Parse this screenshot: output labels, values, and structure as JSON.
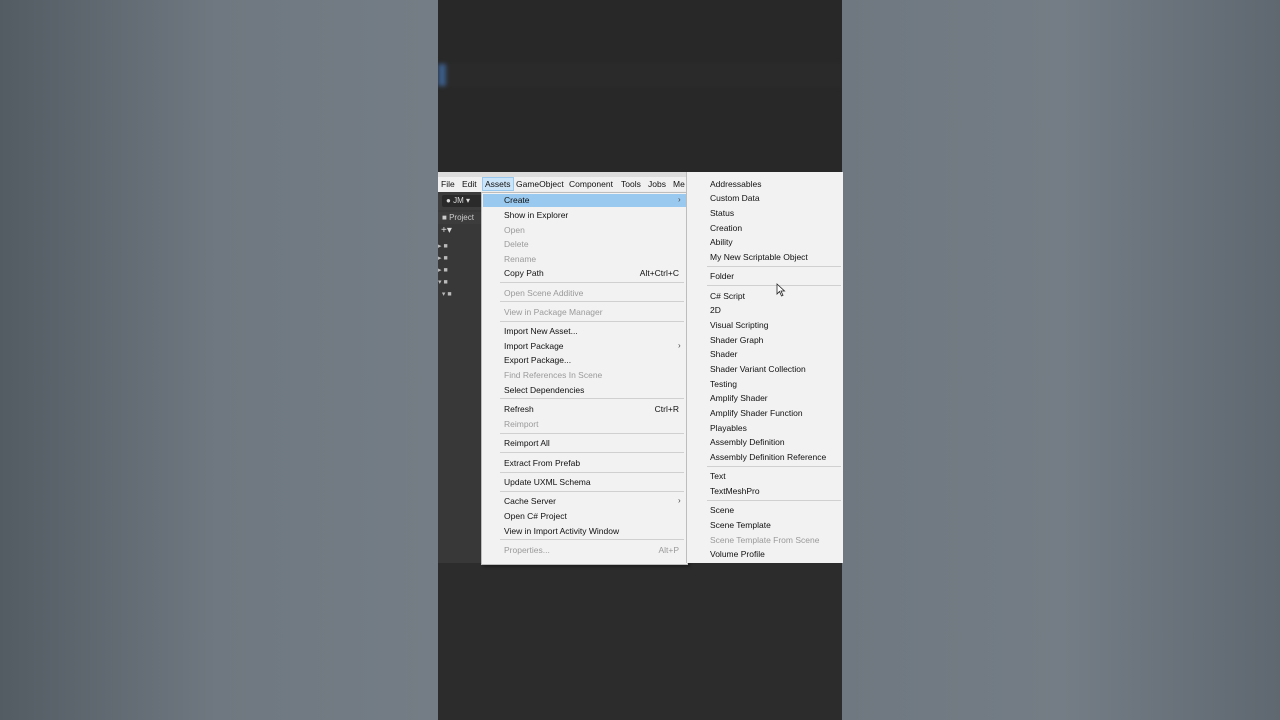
{
  "menubar": {
    "items": [
      "File",
      "Edit",
      "Assets",
      "GameObject",
      "Component",
      "Tools",
      "Jobs",
      "Me"
    ],
    "active": "Assets"
  },
  "toolbar": {
    "account_label": "JM"
  },
  "project_panel": {
    "tab_label": "Project"
  },
  "assets_menu": {
    "items": [
      {
        "label": "Create",
        "has_submenu": true,
        "highlighted": true
      },
      {
        "label": "Show in Explorer"
      },
      {
        "label": "Open",
        "disabled": true
      },
      {
        "label": "Delete",
        "disabled": true
      },
      {
        "label": "Rename",
        "disabled": true
      },
      {
        "label": "Copy Path",
        "shortcut": "Alt+Ctrl+C"
      },
      {
        "label": "Open Scene Additive",
        "disabled": true
      },
      {
        "label": "View in Package Manager",
        "disabled": true
      },
      {
        "label": "Import New Asset..."
      },
      {
        "label": "Import Package",
        "has_submenu": true
      },
      {
        "label": "Export Package..."
      },
      {
        "label": "Find References In Scene",
        "disabled": true
      },
      {
        "label": "Select Dependencies"
      },
      {
        "label": "Refresh",
        "shortcut": "Ctrl+R"
      },
      {
        "label": "Reimport",
        "disabled": true
      },
      {
        "label": "Reimport All"
      },
      {
        "label": "Extract From Prefab"
      },
      {
        "label": "Update UXML Schema"
      },
      {
        "label": "Cache Server",
        "has_submenu": true
      },
      {
        "label": "Open C# Project"
      },
      {
        "label": "View in Import Activity Window"
      },
      {
        "label": "Properties...",
        "shortcut": "Alt+P",
        "disabled": true
      }
    ]
  },
  "create_submenu": {
    "items": [
      {
        "label": "Addressables"
      },
      {
        "label": "Custom Data"
      },
      {
        "label": "Status"
      },
      {
        "label": "Creation"
      },
      {
        "label": "Ability"
      },
      {
        "label": "My New Scriptable Object"
      },
      {
        "label": "Folder"
      },
      {
        "label": "C# Script"
      },
      {
        "label": "2D"
      },
      {
        "label": "Visual Scripting"
      },
      {
        "label": "Shader Graph"
      },
      {
        "label": "Shader"
      },
      {
        "label": "Shader Variant Collection"
      },
      {
        "label": "Testing"
      },
      {
        "label": "Amplify Shader"
      },
      {
        "label": "Amplify Shader Function"
      },
      {
        "label": "Playables"
      },
      {
        "label": "Assembly Definition"
      },
      {
        "label": "Assembly Definition Reference"
      },
      {
        "label": "Text"
      },
      {
        "label": "TextMeshPro"
      },
      {
        "label": "Scene"
      },
      {
        "label": "Scene Template"
      },
      {
        "label": "Scene Template From Scene",
        "disabled": true
      },
      {
        "label": "Volume Profile"
      }
    ]
  },
  "icons": [
    "account-icon",
    "folder-icon",
    "plus-icon",
    "chevron-right-icon",
    "mouse-cursor-icon"
  ]
}
